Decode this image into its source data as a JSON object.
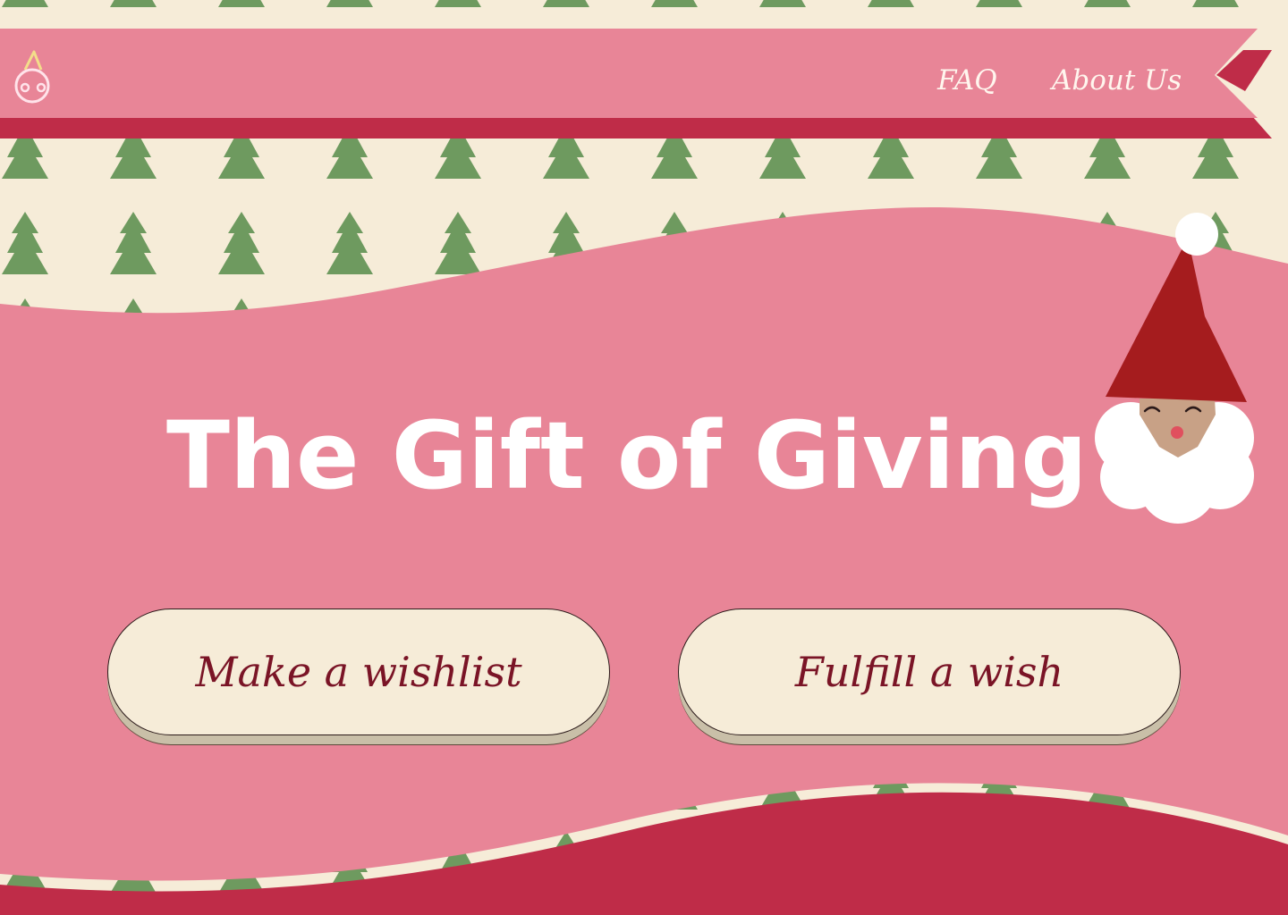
{
  "colors": {
    "background": "#f6ecd8",
    "tree_green": "#6e9a5f",
    "ribbon_pink": "#e88597",
    "ribbon_red": "#bf2c48",
    "button_bg": "#f6ecd8",
    "button_text": "#7a1426",
    "title_text": "#ffffff",
    "hat_red": "#a51c1e",
    "skin": "#c8a186"
  },
  "header": {
    "logo_icon": "gift-bow-icon",
    "nav": [
      {
        "label": "FAQ"
      },
      {
        "label": "About Us"
      }
    ]
  },
  "hero": {
    "title": "The Gift of Giving",
    "illustration": "santa-face-icon"
  },
  "actions": [
    {
      "label": "Make a wishlist"
    },
    {
      "label": "Fulfill a wish"
    }
  ]
}
